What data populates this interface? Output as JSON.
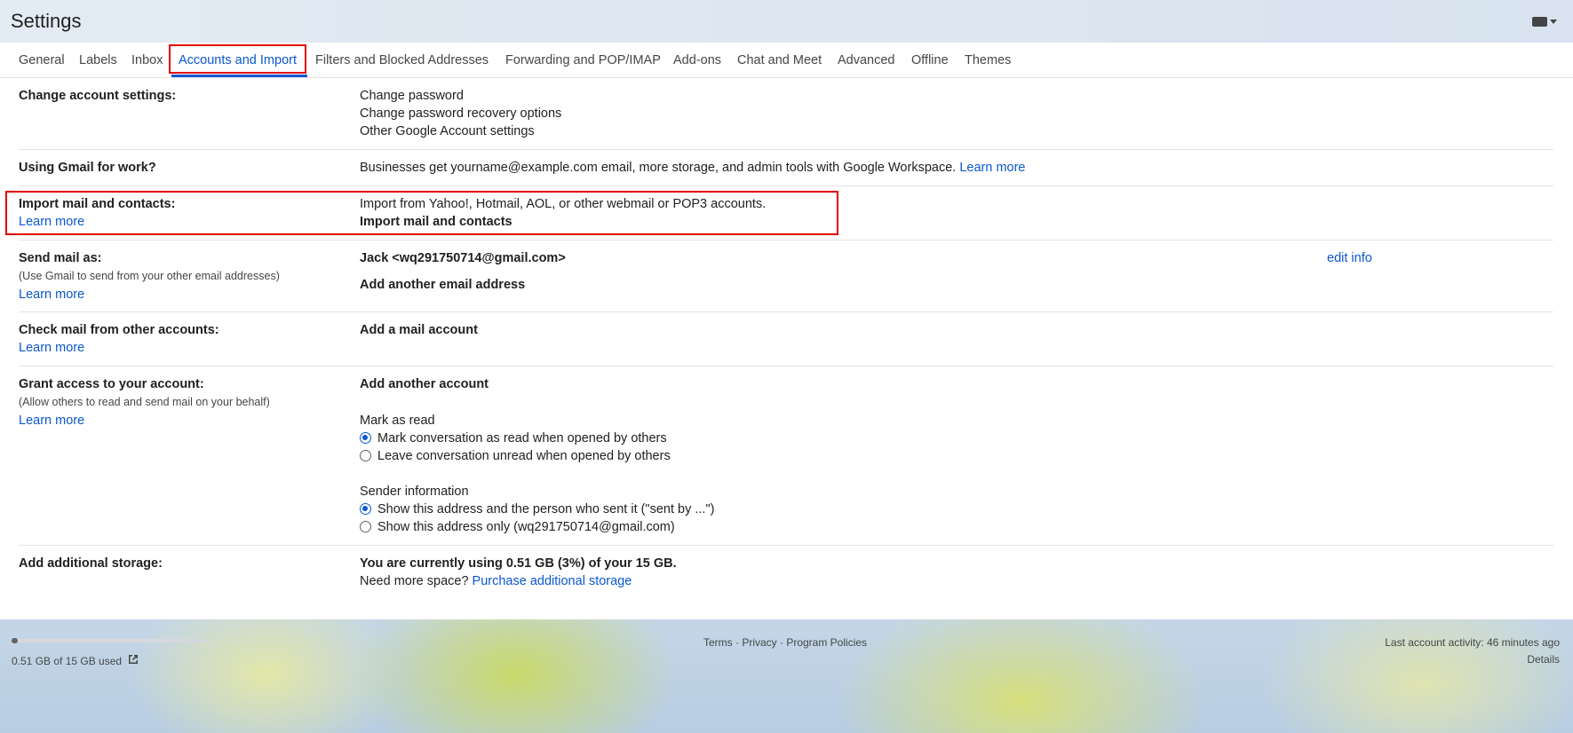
{
  "header": {
    "title": "Settings",
    "keyboard_icon": "keyboard-icon"
  },
  "tabs": [
    {
      "label": "General"
    },
    {
      "label": "Labels"
    },
    {
      "label": "Inbox"
    },
    {
      "label": "Accounts and Import",
      "active": true
    },
    {
      "label": "Filters and Blocked Addresses"
    },
    {
      "label": "Forwarding and POP/IMAP"
    },
    {
      "label": "Add-ons"
    },
    {
      "label": "Chat and Meet"
    },
    {
      "label": "Advanced"
    },
    {
      "label": "Offline"
    },
    {
      "label": "Themes"
    }
  ],
  "sections": {
    "change_account": {
      "label": "Change account settings:",
      "links": [
        "Change password",
        "Change password recovery options",
        "Other Google Account settings"
      ]
    },
    "work": {
      "label": "Using Gmail for work?",
      "text": "Businesses get yourname@example.com email, more storage, and admin tools with Google Workspace.",
      "link": "Learn more"
    },
    "import": {
      "label": "Import mail and contacts:",
      "learn_more": "Learn more",
      "text": "Import from Yahoo!, Hotmail, AOL, or other webmail or POP3 accounts.",
      "action": "Import mail and contacts"
    },
    "send_as": {
      "label": "Send mail as:",
      "sub": "(Use Gmail to send from your other email addresses)",
      "learn_more": "Learn more",
      "address": "Jack <wq291750714@gmail.com>",
      "edit": "edit info",
      "action": "Add another email address"
    },
    "check_mail": {
      "label": "Check mail from other accounts:",
      "learn_more": "Learn more",
      "action": "Add a mail account"
    },
    "grant": {
      "label": "Grant access to your account:",
      "sub": "(Allow others to read and send mail on your behalf)",
      "learn_more": "Learn more",
      "action": "Add another account",
      "mark_read_title": "Mark as read",
      "mark_read_opt1": "Mark conversation as read when opened by others",
      "mark_read_opt2": "Leave conversation unread when opened by others",
      "sender_title": "Sender information",
      "sender_opt1": "Show this address and the person who sent it (\"sent by ...\")",
      "sender_opt2": "Show this address only (wq291750714@gmail.com)"
    },
    "storage": {
      "label": "Add additional storage:",
      "usage": "You are currently using 0.51 GB (3%) of your 15 GB.",
      "need_more": "Need more space?",
      "purchase": "Purchase additional storage"
    }
  },
  "footer": {
    "storage_used": "0.51 GB of 15 GB used",
    "storage_fraction": 0.03,
    "links": "Terms · Privacy · Program Policies",
    "last_activity": "Last account activity: 46 minutes ago",
    "details": "Details"
  },
  "colors": {
    "accent": "#0b57d0",
    "highlight_box": "#e00000"
  }
}
